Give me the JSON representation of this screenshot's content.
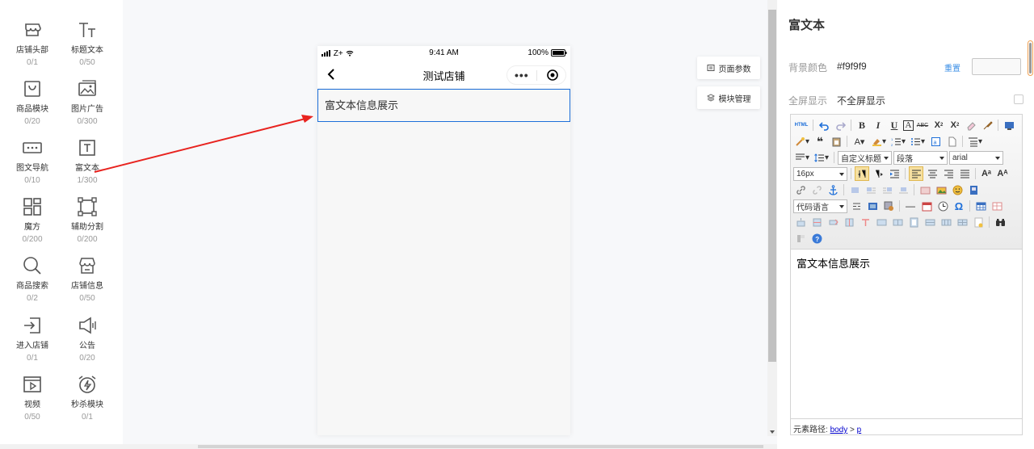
{
  "components": [
    {
      "name": "店铺头部",
      "count": "0/1",
      "icon": "store-header-icon"
    },
    {
      "name": "标题文本",
      "count": "0/50",
      "icon": "title-text-icon"
    },
    {
      "name": "商品模块",
      "count": "0/20",
      "icon": "shopping-bag-icon"
    },
    {
      "name": "图片广告",
      "count": "0/300",
      "icon": "image-ad-icon"
    },
    {
      "name": "图文导航",
      "count": "0/10",
      "icon": "image-nav-icon"
    },
    {
      "name": "富文本",
      "count": "1/300",
      "icon": "rich-text-icon"
    },
    {
      "name": "魔方",
      "count": "0/200",
      "icon": "cube-grid-icon"
    },
    {
      "name": "辅助分割",
      "count": "0/200",
      "icon": "divider-icon"
    },
    {
      "name": "商品搜索",
      "count": "0/2",
      "icon": "search-icon"
    },
    {
      "name": "店铺信息",
      "count": "0/50",
      "icon": "store-info-icon"
    },
    {
      "name": "进入店铺",
      "count": "0/1",
      "icon": "enter-store-icon"
    },
    {
      "name": "公告",
      "count": "0/20",
      "icon": "announcement-icon"
    },
    {
      "name": "视频",
      "count": "0/50",
      "icon": "video-icon"
    },
    {
      "name": "秒杀模块",
      "count": "0/1",
      "icon": "flash-sale-icon"
    }
  ],
  "phone": {
    "carrier": "Z+",
    "time": "9:41 AM",
    "battery": "100%",
    "title": "测试店铺",
    "more": "•••",
    "rich_text": "富文本信息展示"
  },
  "float_buttons": {
    "page_params": "页面参数",
    "module_manage": "模块管理"
  },
  "panel": {
    "title": "富文本",
    "bg_label": "背景颜色",
    "bg_value": "#f9f9f9",
    "reset": "重置",
    "fullscreen_label": "全屏显示",
    "fullscreen_value": "不全屏显示"
  },
  "editor": {
    "custom_title": "自定义标题",
    "paragraph": "段落",
    "font": "arial",
    "font_size": "16px",
    "code_lang": "代码语言",
    "content": "富文本信息展示",
    "path_label": "元素路径:",
    "path_body": "body",
    "path_sep": ">",
    "path_p": "p"
  },
  "colors": {
    "accent": "#1e6fd9",
    "arrow": "#e8231f",
    "link": "#3a8ee6"
  }
}
